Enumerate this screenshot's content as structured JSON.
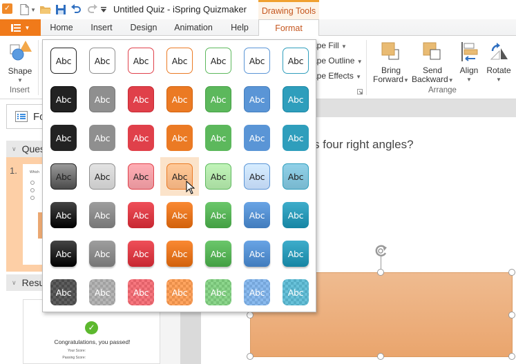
{
  "titlebar": {
    "app_icon": "quizmaker-check-icon",
    "quick_access": [
      "new-document-icon",
      "open-folder-icon",
      "save-icon",
      "undo-icon",
      "redo-icon",
      "customize-caret-icon"
    ],
    "title": "Untitled Quiz - iSpring Quizmaker",
    "context_tab": "Drawing Tools"
  },
  "ribbon_tabs": {
    "file_icon": "menu-icon",
    "tabs": [
      {
        "label": "Home"
      },
      {
        "label": "Insert"
      },
      {
        "label": "Design"
      },
      {
        "label": "Animation"
      },
      {
        "label": "Help"
      },
      {
        "label": "Format",
        "active": true
      }
    ]
  },
  "ribbon": {
    "insert_group": {
      "shape_label": "Shape",
      "group_label": "Insert"
    },
    "shape_styles": {
      "fill_label": "Shape Fill",
      "outline_label": "Shape Outline",
      "effects_label": "Shape Effects",
      "visible_fill": "ape Fill",
      "visible_outline": "ape Outline",
      "visible_effects": "ape Effects"
    },
    "arrange_group": {
      "bring_forward": [
        "Bring",
        "Forward"
      ],
      "send_backward": [
        "Send",
        "Backward"
      ],
      "align": "Align",
      "rotate": "Rotate",
      "group_label": "Arrange"
    }
  },
  "left_panel": {
    "form_button_label": "Fo",
    "questions_header": "Ques",
    "slide_number": "1.",
    "slide_thumb_title": "Which",
    "results_header": "Resu",
    "result_thumb_text": "Congratulations, you passed!",
    "result_rows": [
      "Your Score:",
      "Passing Score:"
    ]
  },
  "canvas": {
    "question_text": "s four right angles?",
    "shape_fill": "#eba872"
  },
  "gallery": {
    "label": "Abc",
    "hovered": {
      "row": 3,
      "col": 3
    },
    "colors": [
      "#222222",
      "#8f8f8f",
      "#e0404a",
      "#eb7a24",
      "#5cb85c",
      "#5a95d6",
      "#2f9ebc"
    ],
    "light_colors": [
      "#5a5a5a",
      "#cacaca",
      "#e6959c",
      "#eeb07f",
      "#a8dba0",
      "#bed4f0",
      "#78b8cf"
    ],
    "rows": [
      "outline",
      "solid",
      "solid-flat",
      "light-gradient",
      "gradient",
      "gradient-shadow",
      "transparent"
    ]
  }
}
